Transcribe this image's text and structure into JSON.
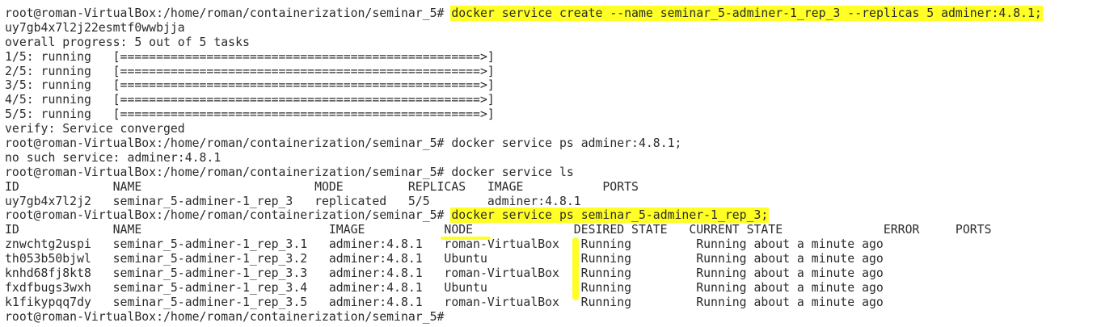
{
  "prompt": "root@roman-VirtualBox:/home/roman/containerization/seminar_5#",
  "highlight_color": "#ffff26",
  "text_color": "#2b2b2b",
  "background_color": "#ffffff",
  "lines": [
    {
      "kind": "cmd",
      "command": "docker service create --name seminar_5-adminer-1_rep_3 --replicas 5 adminer:4.8.1;",
      "highlighted": true
    },
    {
      "kind": "out",
      "text": "uy7gb4x7l2j22esmtf0wwbjja"
    },
    {
      "kind": "out",
      "text": "overall progress: 5 out of 5 tasks"
    },
    {
      "kind": "out",
      "text": "1/5: running   [==================================================>]"
    },
    {
      "kind": "out",
      "text": "2/5: running   [==================================================>]"
    },
    {
      "kind": "out",
      "text": "3/5: running   [==================================================>]"
    },
    {
      "kind": "out",
      "text": "4/5: running   [==================================================>]"
    },
    {
      "kind": "out",
      "text": "5/5: running   [==================================================>]"
    },
    {
      "kind": "out",
      "text": "verify: Service converged"
    },
    {
      "kind": "cmd",
      "command": "docker service ps adminer:4.8.1;",
      "highlighted": false
    },
    {
      "kind": "out",
      "text": "no such service: adminer:4.8.1"
    },
    {
      "kind": "cmd",
      "command": "docker service ls",
      "highlighted": false
    },
    {
      "kind": "out",
      "text": "ID             NAME                        MODE         REPLICAS   IMAGE           PORTS"
    },
    {
      "kind": "out",
      "text": "uy7gb4x7l2j2   seminar_5-adminer-1_rep_3   replicated   5/5        adminer:4.8.1"
    },
    {
      "kind": "cmd",
      "command": "docker service ps seminar_5-adminer-1_rep_3;",
      "highlighted": true
    },
    {
      "kind": "hdr",
      "segments": [
        {
          "text": "ID             NAME                          IMAGE           ",
          "highlighted": false
        },
        {
          "text": "NODE",
          "highlighted": true,
          "name": "node-column-header"
        },
        {
          "text": "              DESIRED STATE   CURRENT STATE              ERROR     PORTS",
          "highlighted": false
        }
      ]
    },
    {
      "kind": "out",
      "text": "znwchtg2uspi   seminar_5-adminer-1_rep_3.1   adminer:4.8.1   roman-VirtualBox   Running         Running about a minute ago"
    },
    {
      "kind": "out",
      "text": "th053b50bjwl   seminar_5-adminer-1_rep_3.2   adminer:4.8.1   Ubuntu             Running         Running about a minute ago"
    },
    {
      "kind": "out",
      "text": "knhd68fj8kt8   seminar_5-adminer-1_rep_3.3   adminer:4.8.1   roman-VirtualBox   Running         Running about a minute ago"
    },
    {
      "kind": "out",
      "text": "fxdfbugs3wxh   seminar_5-adminer-1_rep_3.4   adminer:4.8.1   Ubuntu             Running         Running about a minute ago"
    },
    {
      "kind": "out",
      "text": "k1fikypqq7dy   seminar_5-adminer-1_rep_3.5   adminer:4.8.1   roman-VirtualBox   Running         Running about a minute ago"
    },
    {
      "kind": "cmd",
      "command": "",
      "highlighted": false
    }
  ]
}
